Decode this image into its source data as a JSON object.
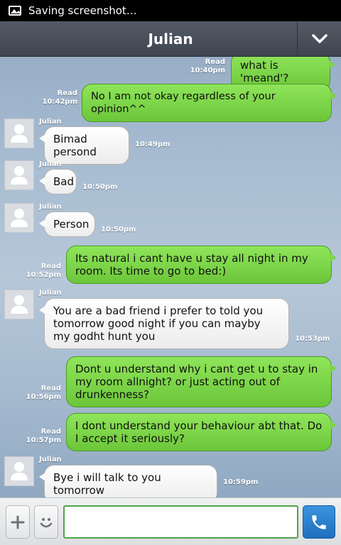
{
  "status_bar": {
    "text": "Saving screenshot…",
    "icon": "image-icon"
  },
  "header": {
    "title": "Julian",
    "toggle_icon": "chevron-down-icon"
  },
  "messages": [
    {
      "type": "sent",
      "text": "what is 'meand'?",
      "read": "Read",
      "time": "10:40pm"
    },
    {
      "type": "sent",
      "text": "No I am not okay regardless of your opinion^^",
      "read": "Read",
      "time": "10:42pm"
    },
    {
      "type": "received",
      "sender": "Julian",
      "text": "Bimad persond",
      "time": "10:49pm"
    },
    {
      "type": "received",
      "sender": "Julian",
      "text": "Bad",
      "time": "10:50pm"
    },
    {
      "type": "received",
      "sender": "Julian",
      "text": "Person",
      "time": "10:50pm"
    },
    {
      "type": "sent",
      "text": "Its natural i cant have u stay all night in my room. Its time to go to bed:)",
      "read": "Read",
      "time": "10:52pm"
    },
    {
      "type": "received",
      "sender": "Julian",
      "text": "You are a bad friend i prefer to told you tomorrow good night if you can mayby my godht hunt you",
      "time": "10:53pm"
    },
    {
      "type": "sent",
      "text": "Dont u understand why i cant get u to stay in my room allnight? or just acting out of drunkenness?",
      "read": "Read",
      "time": "10:56pm"
    },
    {
      "type": "sent",
      "text": "I dont understand your behaviour abt that. Do I accept it seriously?",
      "read": "Read",
      "time": "10:57pm"
    },
    {
      "type": "received",
      "sender": "Julian",
      "text": "Bye i will talk to you tomorrow",
      "time": "10:59pm"
    }
  ],
  "input_bar": {
    "plus_icon": "plus-icon",
    "emoji_icon": "emoji-icon",
    "call_icon": "phone-icon",
    "placeholder": ""
  },
  "colors": {
    "sent_bubble": "#7ed44a",
    "received_bubble": "#ffffff",
    "header": "#4b515c",
    "call_button": "#2b7fd0"
  }
}
